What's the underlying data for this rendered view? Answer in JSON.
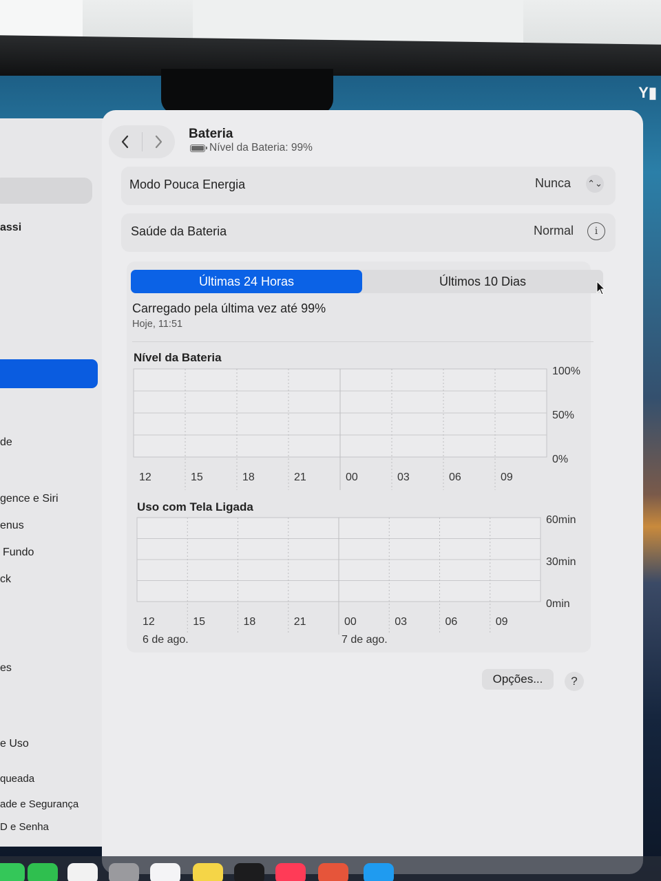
{
  "window": {
    "title": "Bateria",
    "subtitle": "Nível da Bateria: 99%"
  },
  "sidebar": {
    "items": [
      {
        "label": "assi"
      },
      {
        "label": "de"
      },
      {
        "label": "gence e Siri"
      },
      {
        "label": "enus"
      },
      {
        "label": "Fundo"
      },
      {
        "label": "ck"
      },
      {
        "label": "es"
      },
      {
        "label": "e Uso"
      },
      {
        "label": "queada"
      },
      {
        "label": "ade e Segurança"
      },
      {
        "label": "D e Senha"
      }
    ]
  },
  "settings": {
    "low_power": {
      "label": "Modo Pouca Energia",
      "value": "Nunca"
    },
    "health": {
      "label": "Saúde da Bateria",
      "value": "Normal"
    }
  },
  "tabs": {
    "active": "Últimas 24 Horas",
    "inactive": "Últimos 10 Dias"
  },
  "charge_info": {
    "text": "Carregado pela última vez até 99%",
    "time": "Hoje, 11:51"
  },
  "buttons": {
    "options": "Opções...",
    "help": "?"
  },
  "colors": {
    "accent": "#0b62e6",
    "window_bg": "#ececee"
  },
  "chart_data": [
    {
      "type": "bar",
      "title": "Nível da Bateria",
      "categories": [
        "12",
        "15",
        "18",
        "21",
        "00",
        "03",
        "06",
        "09"
      ],
      "y_ticks": [
        "100%",
        "50%",
        "0%"
      ],
      "ylim": [
        0,
        100
      ],
      "values": [],
      "grid": true
    },
    {
      "type": "bar",
      "title": "Uso com Tela Ligada",
      "categories": [
        "12",
        "15",
        "18",
        "21",
        "00",
        "03",
        "06",
        "09"
      ],
      "date_labels": [
        "6 de ago.",
        "7 de ago."
      ],
      "y_ticks": [
        "60min",
        "30min",
        "0min"
      ],
      "ylim": [
        0,
        60
      ],
      "values": [],
      "grid": true
    }
  ]
}
